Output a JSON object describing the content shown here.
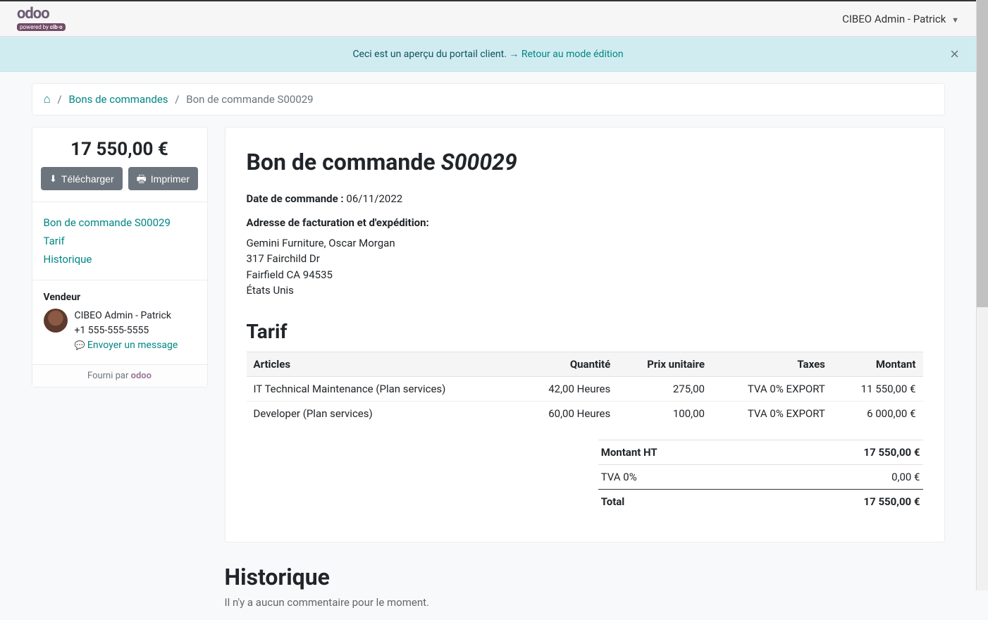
{
  "topbar": {
    "user_label": "CIBEO Admin - Patrick"
  },
  "alert": {
    "text_preview": "Ceci est un aperçu du portail client. ",
    "back_link": " Retour au mode édition"
  },
  "breadcrumb": {
    "items": [
      {
        "label": "Bons de commandes",
        "link": true
      },
      {
        "label": "Bon de commande S00029",
        "link": false
      }
    ]
  },
  "sidebar": {
    "total_amount": "17 550,00 €",
    "download_label": " Télécharger",
    "print_label": " Imprimer",
    "nav": [
      "Bon de commande S00029",
      "Tarif",
      "Historique"
    ],
    "seller_title": "Vendeur",
    "seller_name": "CIBEO Admin - Patrick",
    "seller_phone": "+1 555-555-5555",
    "send_message": " Envoyer un message",
    "powered_by": "Fourni par ",
    "odoo_brand": "odoo"
  },
  "main": {
    "title_prefix": "Bon de commande ",
    "order_number": "S00029",
    "date_label": "Date de commande : ",
    "date_value": "06/11/2022",
    "addr_title": "Adresse de facturation et d'expédition:",
    "addr_lines": [
      "Gemini Furniture, Oscar Morgan",
      "317 Fairchild Dr",
      "Fairfield CA 94535",
      "États Unis"
    ],
    "section_tarif": "Tarif",
    "columns": {
      "article": "Articles",
      "qty": "Quantité",
      "unit_price": "Prix unitaire",
      "taxes": "Taxes",
      "amount": "Montant"
    },
    "lines": [
      {
        "article": "IT Technical Maintenance (Plan services)",
        "qty": "42,00 Heures",
        "unit_price": "275,00",
        "taxes": "TVA 0% EXPORT",
        "amount": "11 550,00 €"
      },
      {
        "article": "Developer (Plan services)",
        "qty": "60,00 Heures",
        "unit_price": "100,00",
        "taxes": "TVA 0% EXPORT",
        "amount": "6 000,00 €"
      }
    ],
    "totals": {
      "subtotal_label": "Montant HT",
      "subtotal_value": "17 550,00 €",
      "tax_label": "TVA 0%",
      "tax_value": "0,00 €",
      "total_label": "Total",
      "total_value": "17 550,00 €"
    }
  },
  "history": {
    "heading": "Historique",
    "empty": "Il n'y a aucun commentaire pour le moment."
  }
}
